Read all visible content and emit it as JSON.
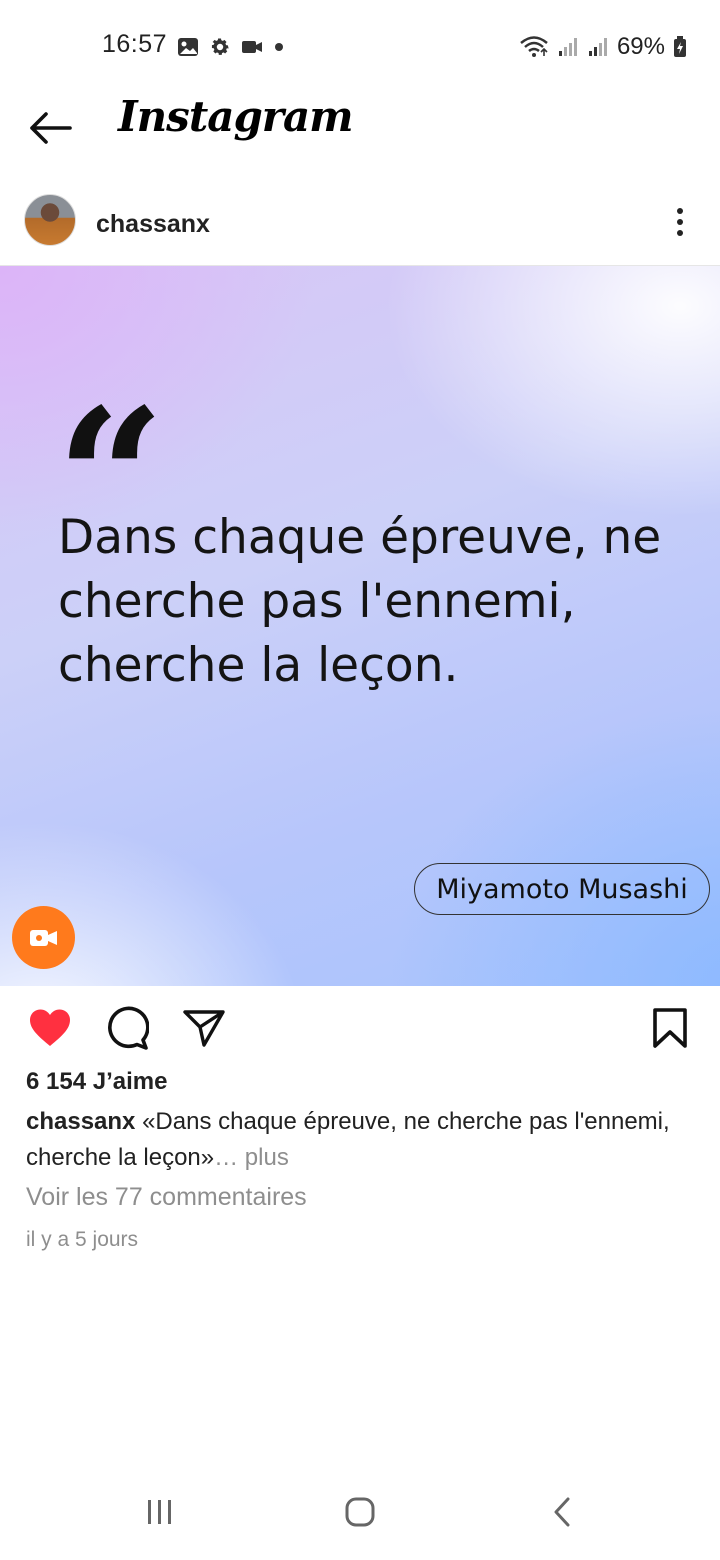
{
  "status_bar": {
    "time": "16:57",
    "battery": "69%",
    "icons": [
      "gallery-icon",
      "gear-icon",
      "video-camera-icon",
      "dot-icon",
      "wifi-icon",
      "signal-icon",
      "signal-icon",
      "battery-icon"
    ]
  },
  "header": {
    "title": "Instagram",
    "back_icon": "arrow-left-icon"
  },
  "post": {
    "username": "chassanx",
    "quote_mark": "“",
    "quote_text": "Dans chaque épreuve, ne cherche pas l'ennemi, cherche la leçon.",
    "author": "Miyamoto Musashi",
    "likes": "6 154 J’aime",
    "caption_user": "chassanx",
    "caption_text": " «Dans chaque épreuve, ne cherche pas l'ennemi, cherche la leçon»",
    "caption_more": "… plus",
    "comments_link": "Voir les 77 commentaires",
    "time_ago": "il y a 5 jours",
    "liked": true,
    "colors": {
      "like": "#ff3040",
      "fab": "#ff7a1c",
      "muted_text": "#8e8e8e"
    }
  }
}
